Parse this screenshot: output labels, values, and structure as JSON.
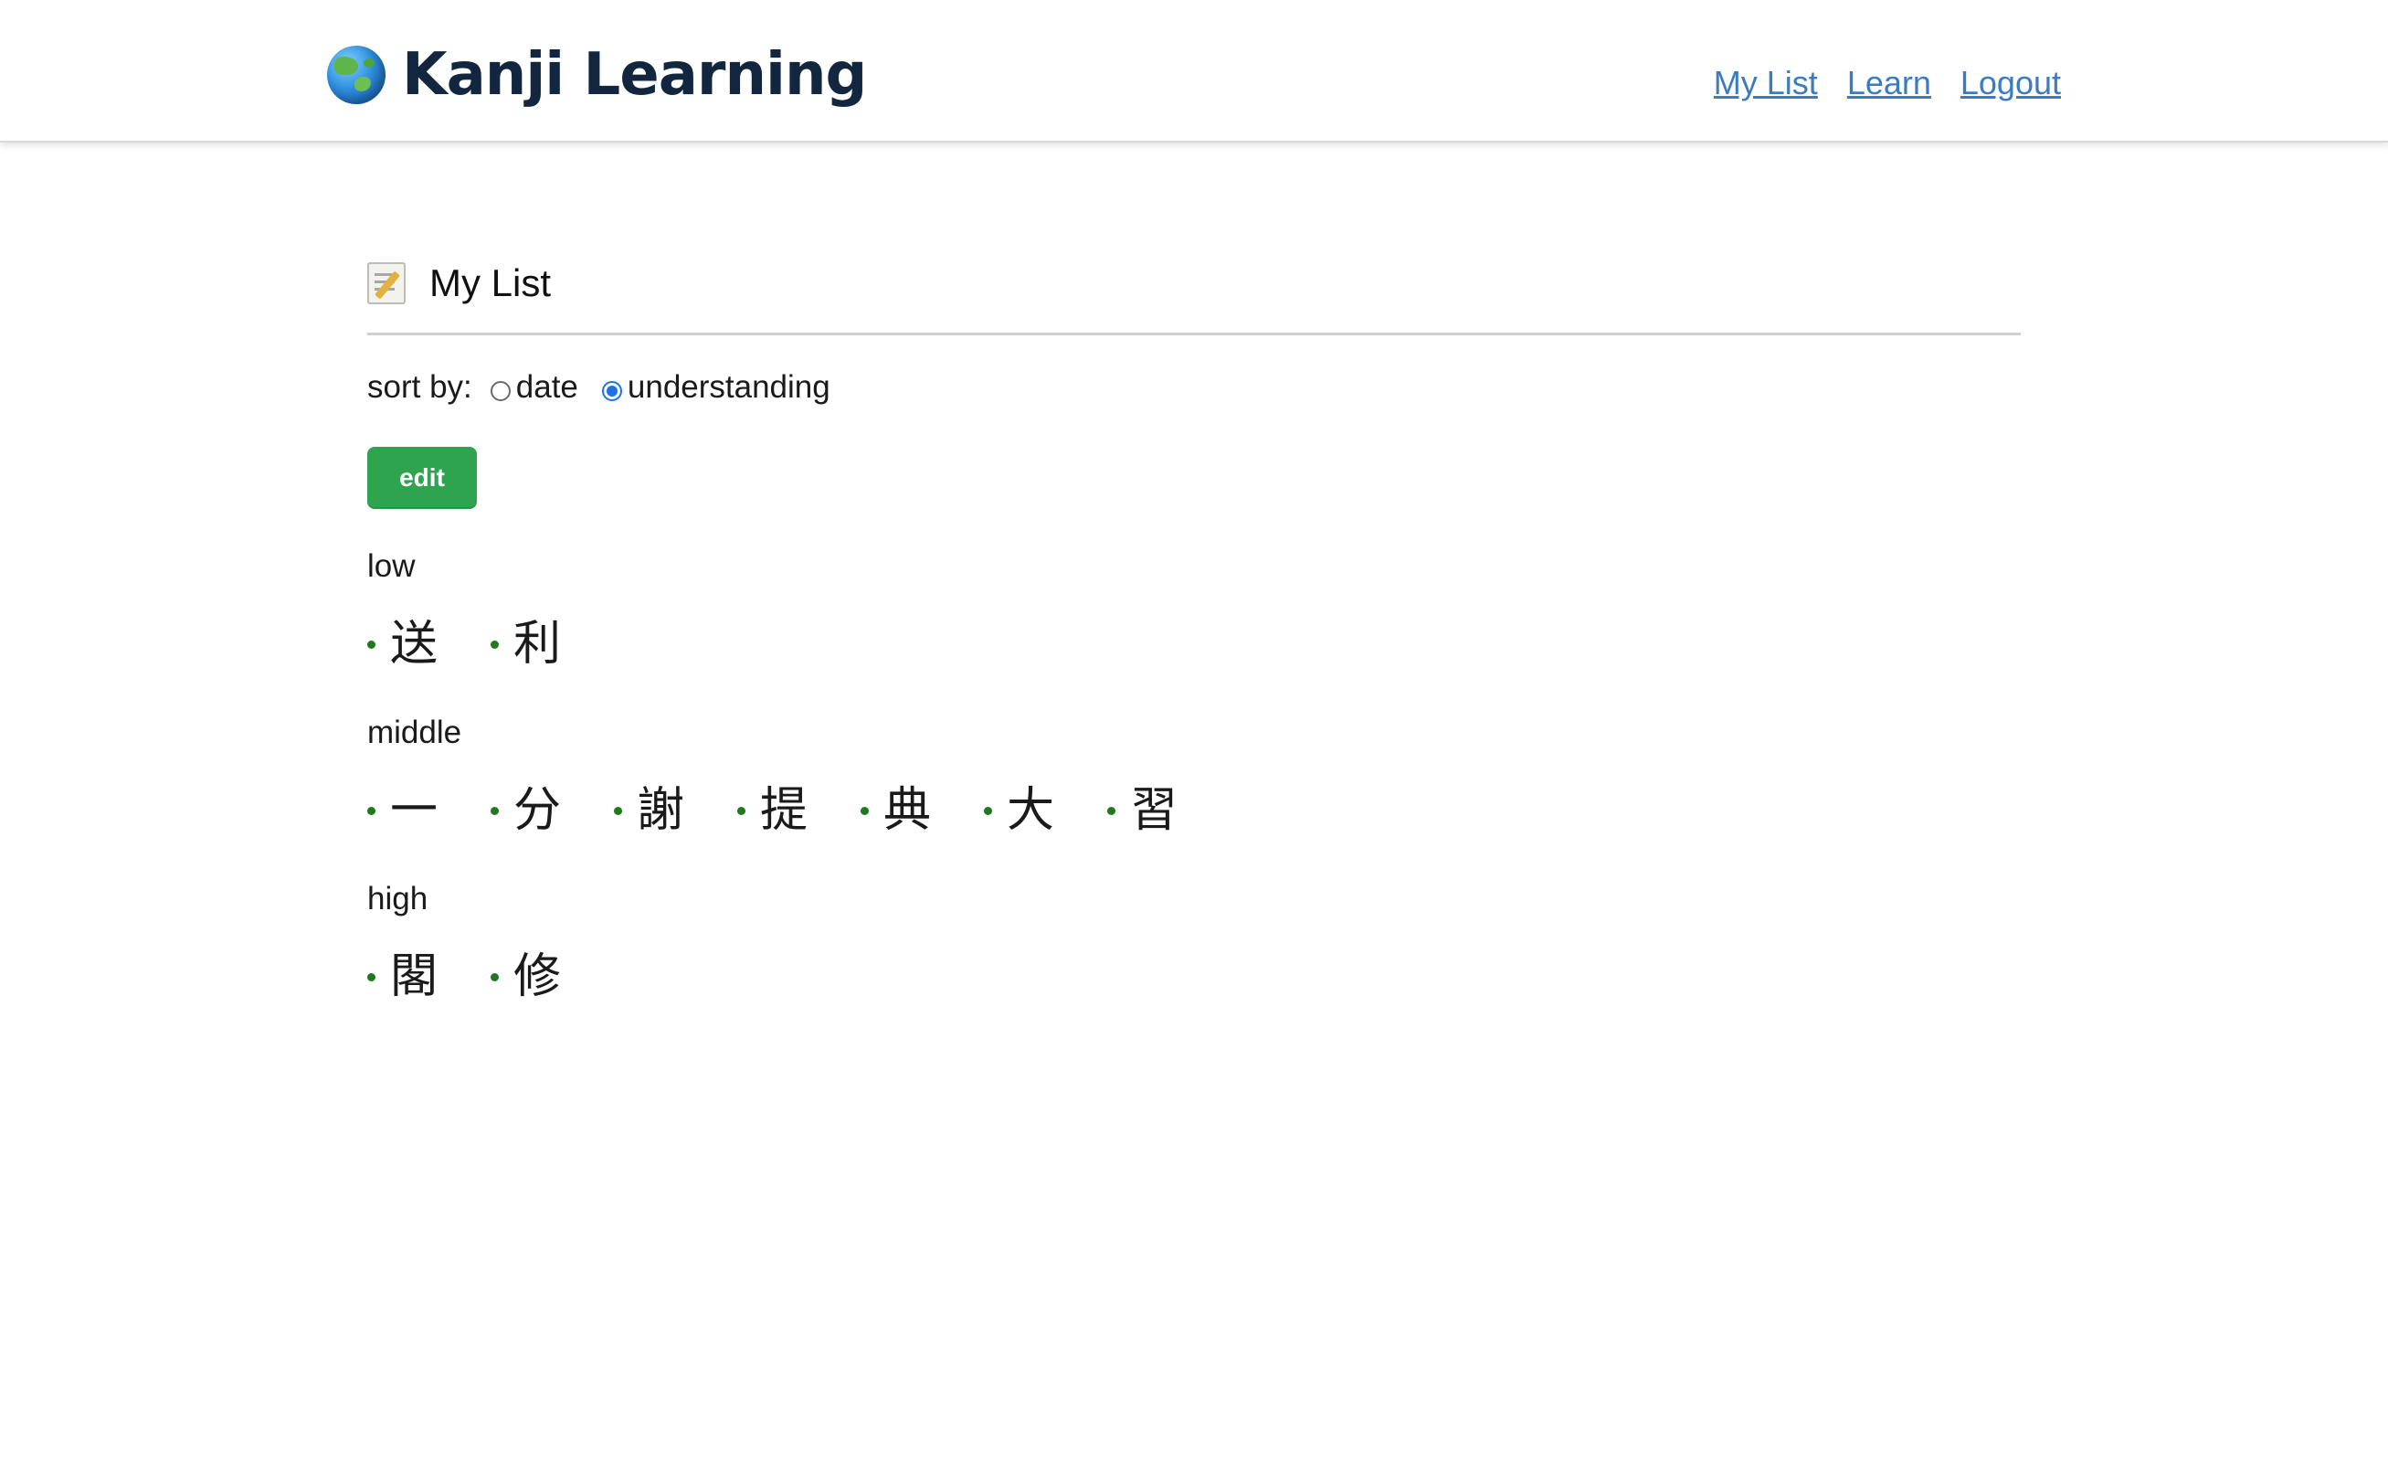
{
  "header": {
    "title": "Kanji Learning",
    "logo_icon": "globe-icon",
    "nav": [
      {
        "label": "My List"
      },
      {
        "label": "Learn"
      },
      {
        "label": "Logout"
      }
    ]
  },
  "main": {
    "title": "My List",
    "title_icon": "memo-icon",
    "sort": {
      "label": "sort by:",
      "options": [
        {
          "label": "date",
          "checked": false
        },
        {
          "label": "understanding",
          "checked": true
        }
      ]
    },
    "edit_label": "edit",
    "groups": [
      {
        "label": "low",
        "kanji": [
          "送",
          "利"
        ]
      },
      {
        "label": "middle",
        "kanji": [
          "一",
          "分",
          "謝",
          "提",
          "典",
          "大",
          "習"
        ]
      },
      {
        "label": "high",
        "kanji": [
          "閣",
          "修"
        ]
      }
    ]
  },
  "colors": {
    "link": "#3b7bbf",
    "button": "#2ea44f",
    "bullet": "#1f7a1f",
    "radio_checked": "#1a73e8",
    "brand_text": "#12263f"
  }
}
